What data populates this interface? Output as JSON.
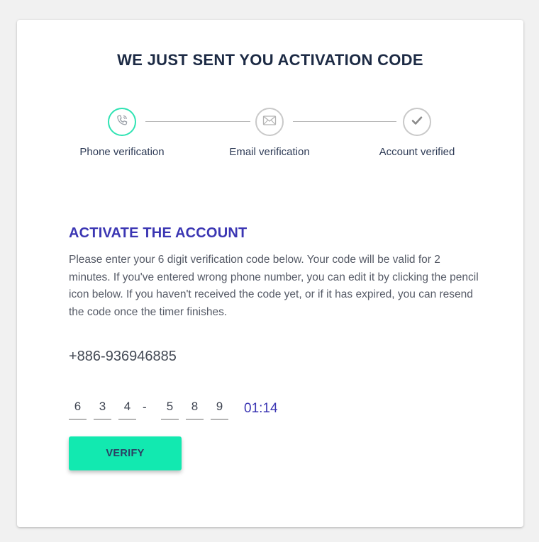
{
  "header": {
    "title": "WE JUST SENT YOU ACTIVATION CODE"
  },
  "stepper": {
    "steps": [
      {
        "label": "Phone verification",
        "icon": "phone-icon",
        "state": "active"
      },
      {
        "label": "Email verification",
        "icon": "envelope-icon",
        "state": "pending"
      },
      {
        "label": "Account verified",
        "icon": "checkmark-icon",
        "state": "pending"
      }
    ]
  },
  "activation": {
    "title": "ACTIVATE THE ACCOUNT",
    "description": "Please enter your 6 digit verification code below. Your code will be valid for 2 minutes. If you've entered wrong phone number, you can edit it by clicking the pencil icon below. If you haven't received the code yet, or if it has expired, you can resend the code once the timer finishes.",
    "phone": "+886-936946885",
    "code_digits": [
      "6",
      "3",
      "4",
      "5",
      "8",
      "9"
    ],
    "code_separator": "-",
    "timer": "01:14",
    "verify_label": "VERIFY"
  },
  "colors": {
    "accent": "#12e9b0",
    "active_ring": "#2fe3b3",
    "heading_blue": "#3b36b3",
    "title_dark": "#1c2a44"
  }
}
